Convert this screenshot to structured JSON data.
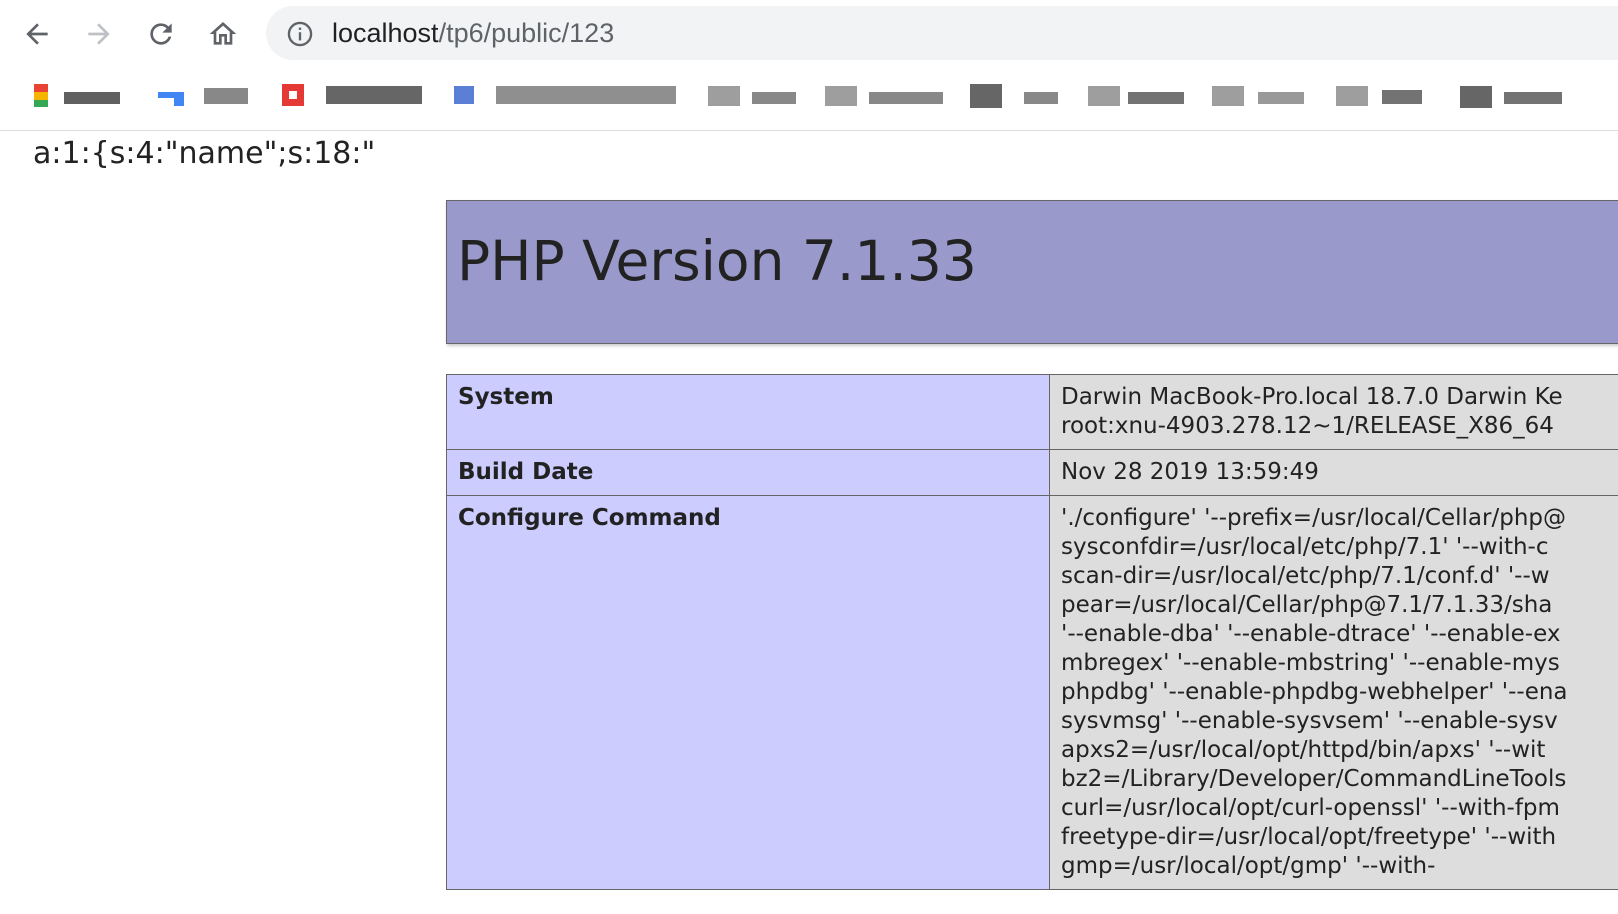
{
  "browser": {
    "url_host": "localhost",
    "url_path": "/tp6/public/123"
  },
  "icons": {
    "back": "back-arrow-icon",
    "forward": "forward-arrow-icon",
    "reload": "reload-icon",
    "home": "home-icon",
    "info": "info-icon"
  },
  "page": {
    "serialized_output": "a:1:{s:4:\"name\";s:18:\"",
    "php_title": "PHP Version 7.1.33",
    "rows": [
      {
        "label": "System",
        "lines": [
          "Darwin MacBook-Pro.local 18.7.0 Darwin Ke",
          "root:xnu-4903.278.12~1/RELEASE_X86_64"
        ]
      },
      {
        "label": "Build Date",
        "lines": [
          "Nov 28 2019 13:59:49"
        ]
      },
      {
        "label": "Configure Command",
        "lines": [
          "'./configure' '--prefix=/usr/local/Cellar/php@",
          "sysconfdir=/usr/local/etc/php/7.1' '--with-c",
          "scan-dir=/usr/local/etc/php/7.1/conf.d' '--w",
          "pear=/usr/local/Cellar/php@7.1/7.1.33/sha",
          "'--enable-dba' '--enable-dtrace' '--enable-ex",
          "mbregex' '--enable-mbstring' '--enable-mys",
          "phpdbg' '--enable-phpdbg-webhelper' '--ena",
          "sysvmsg' '--enable-sysvsem' '--enable-sysv",
          "apxs2=/usr/local/opt/httpd/bin/apxs' '--wit",
          "bz2=/Library/Developer/CommandLineTools",
          "curl=/usr/local/opt/curl-openssl' '--with-fpm",
          "freetype-dir=/usr/local/opt/freetype' '--with",
          "gmp=/usr/local/opt/gmp' '--with-"
        ]
      }
    ]
  },
  "colors": {
    "php_header_bg": "#9999cc",
    "label_cell_bg": "#ccccff",
    "value_cell_bg": "#dddddd",
    "omnibox_bg": "#f1f3f4"
  }
}
